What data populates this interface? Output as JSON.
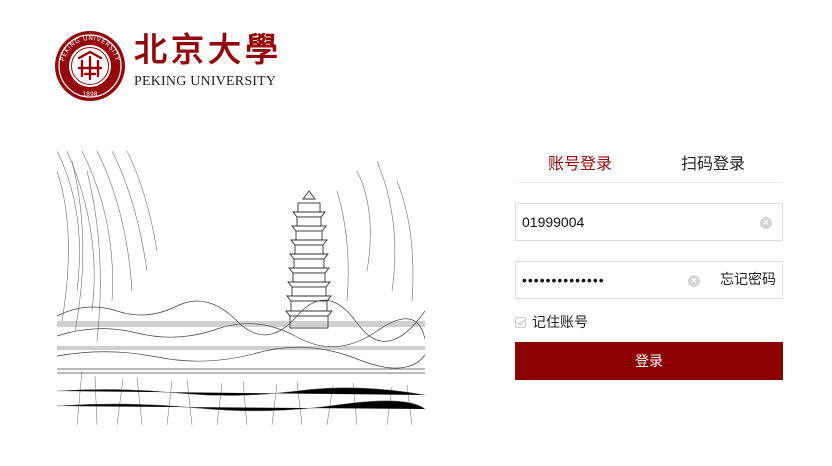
{
  "header": {
    "logo_cn": "北京大學",
    "logo_en": "PEKING UNIVERSITY",
    "seal_text_top": "PEKING UNIVERSITY",
    "seal_year": "1898",
    "brand_color": "#94070a"
  },
  "login": {
    "tabs": [
      {
        "label": "账号登录",
        "active": true
      },
      {
        "label": "扫码登录",
        "active": false
      }
    ],
    "username": {
      "value": "01999004",
      "clear_icon": "clear-circle-icon"
    },
    "password": {
      "value": "••••••••••••••",
      "clear_icon": "clear-circle-icon",
      "forgot_label": "忘记密码"
    },
    "remember": {
      "label": "记住账号",
      "checked": true
    },
    "submit_label": "登录",
    "button_color": "#8b0000"
  }
}
